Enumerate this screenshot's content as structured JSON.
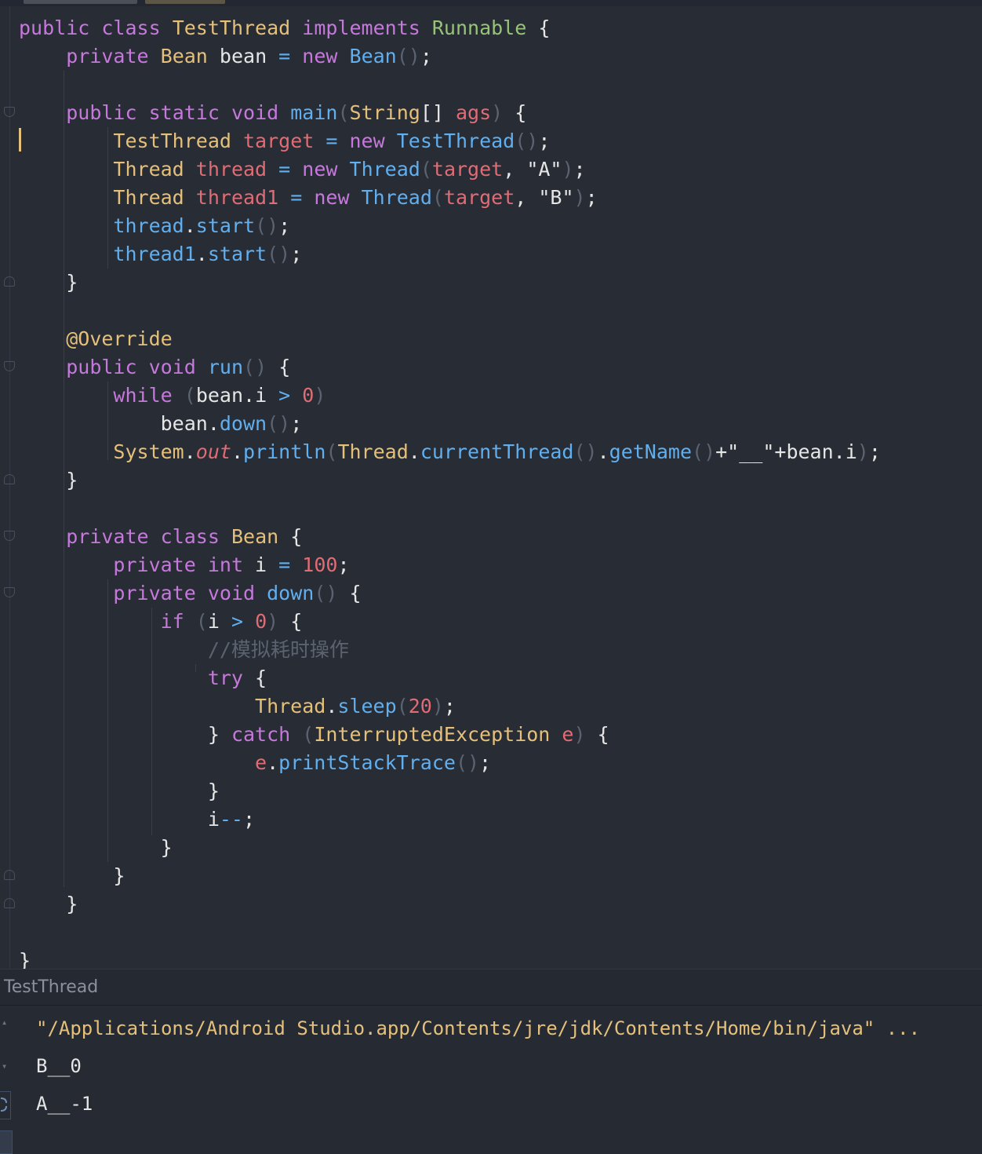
{
  "editor": {
    "lines": [
      [
        [
          "kw",
          "public"
        ],
        [
          "pl",
          " "
        ],
        [
          "kw",
          "class"
        ],
        [
          "pl",
          " "
        ],
        [
          "ty",
          "TestThread"
        ],
        [
          "pl",
          " "
        ],
        [
          "kw",
          "implements"
        ],
        [
          "pl",
          " "
        ],
        [
          "gr",
          "Runnable"
        ],
        [
          "pl",
          " {"
        ]
      ],
      [
        [
          "pl",
          "    "
        ],
        [
          "kw",
          "private"
        ],
        [
          "pl",
          " "
        ],
        [
          "ty",
          "Bean"
        ],
        [
          "pl",
          " bean "
        ],
        [
          "op",
          "="
        ],
        [
          "pl",
          " "
        ],
        [
          "kw",
          "new"
        ],
        [
          "pl",
          " "
        ],
        [
          "fn",
          "Bean"
        ],
        [
          "pu",
          "()"
        ],
        [
          "pl",
          ";"
        ]
      ],
      [],
      [
        [
          "pl",
          "    "
        ],
        [
          "kw",
          "public"
        ],
        [
          "pl",
          " "
        ],
        [
          "kw",
          "static"
        ],
        [
          "pl",
          " "
        ],
        [
          "kw",
          "void"
        ],
        [
          "pl",
          " "
        ],
        [
          "fn",
          "main"
        ],
        [
          "pu",
          "("
        ],
        [
          "ty",
          "String"
        ],
        [
          "pl",
          "[] "
        ],
        [
          "par",
          "ags"
        ],
        [
          "pu",
          ")"
        ],
        [
          "pl",
          " {"
        ]
      ],
      [
        [
          "pl",
          "        "
        ],
        [
          "ty",
          "TestThread"
        ],
        [
          "pl",
          " "
        ],
        [
          "par",
          "target"
        ],
        [
          "pl",
          " "
        ],
        [
          "op",
          "="
        ],
        [
          "pl",
          " "
        ],
        [
          "kw",
          "new"
        ],
        [
          "pl",
          " "
        ],
        [
          "fn",
          "TestThread"
        ],
        [
          "pu",
          "()"
        ],
        [
          "pl",
          ";"
        ]
      ],
      [
        [
          "pl",
          "        "
        ],
        [
          "ty",
          "Thread"
        ],
        [
          "pl",
          " "
        ],
        [
          "par",
          "thread"
        ],
        [
          "pl",
          " "
        ],
        [
          "op",
          "="
        ],
        [
          "pl",
          " "
        ],
        [
          "kw",
          "new"
        ],
        [
          "pl",
          " "
        ],
        [
          "fn",
          "Thread"
        ],
        [
          "pu",
          "("
        ],
        [
          "par",
          "target"
        ],
        [
          "pl",
          ", "
        ],
        [
          "st",
          "\"A\""
        ],
        [
          "pu",
          ")"
        ],
        [
          "pl",
          ";"
        ]
      ],
      [
        [
          "pl",
          "        "
        ],
        [
          "ty",
          "Thread"
        ],
        [
          "pl",
          " "
        ],
        [
          "par",
          "thread1"
        ],
        [
          "pl",
          " "
        ],
        [
          "op",
          "="
        ],
        [
          "pl",
          " "
        ],
        [
          "kw",
          "new"
        ],
        [
          "pl",
          " "
        ],
        [
          "fn",
          "Thread"
        ],
        [
          "pu",
          "("
        ],
        [
          "par",
          "target"
        ],
        [
          "pl",
          ", "
        ],
        [
          "st",
          "\"B\""
        ],
        [
          "pu",
          ")"
        ],
        [
          "pl",
          ";"
        ]
      ],
      [
        [
          "pl",
          "        "
        ],
        [
          "fn",
          "thread"
        ],
        [
          "pl",
          "."
        ],
        [
          "fn",
          "start"
        ],
        [
          "pu",
          "()"
        ],
        [
          "pl",
          ";"
        ]
      ],
      [
        [
          "pl",
          "        "
        ],
        [
          "fn",
          "thread1"
        ],
        [
          "pl",
          "."
        ],
        [
          "fn",
          "start"
        ],
        [
          "pu",
          "()"
        ],
        [
          "pl",
          ";"
        ]
      ],
      [
        [
          "pl",
          "    }"
        ]
      ],
      [],
      [
        [
          "pl",
          "    "
        ],
        [
          "an",
          "@Override"
        ]
      ],
      [
        [
          "pl",
          "    "
        ],
        [
          "kw",
          "public"
        ],
        [
          "pl",
          " "
        ],
        [
          "kw",
          "void"
        ],
        [
          "pl",
          " "
        ],
        [
          "fn",
          "run"
        ],
        [
          "pu",
          "()"
        ],
        [
          "pl",
          " {"
        ]
      ],
      [
        [
          "pl",
          "        "
        ],
        [
          "kw",
          "while"
        ],
        [
          "pl",
          " "
        ],
        [
          "pu",
          "("
        ],
        [
          "pl",
          "bean.i "
        ],
        [
          "op",
          ">"
        ],
        [
          "pl",
          " "
        ],
        [
          "nu",
          "0"
        ],
        [
          "pu",
          ")"
        ]
      ],
      [
        [
          "pl",
          "            bean."
        ],
        [
          "fn",
          "down"
        ],
        [
          "pu",
          "()"
        ],
        [
          "pl",
          ";"
        ]
      ],
      [
        [
          "pl",
          "        "
        ],
        [
          "ty",
          "System"
        ],
        [
          "pl",
          "."
        ],
        [
          "fi",
          "out"
        ],
        [
          "pl",
          "."
        ],
        [
          "fn",
          "println"
        ],
        [
          "pu",
          "("
        ],
        [
          "ty",
          "Thread"
        ],
        [
          "pl",
          "."
        ],
        [
          "fn",
          "currentThread"
        ],
        [
          "pu",
          "()"
        ],
        [
          "pl",
          "."
        ],
        [
          "fn",
          "getName"
        ],
        [
          "pu",
          "()"
        ],
        [
          "pl",
          "+\""
        ],
        [
          "st",
          "__"
        ],
        [
          "pl",
          "\"+bean.i"
        ],
        [
          "pu",
          ")"
        ],
        [
          "pl",
          ";"
        ]
      ],
      [
        [
          "pl",
          "    }"
        ]
      ],
      [],
      [
        [
          "pl",
          "    "
        ],
        [
          "kw",
          "private"
        ],
        [
          "pl",
          " "
        ],
        [
          "kw",
          "class"
        ],
        [
          "pl",
          " "
        ],
        [
          "ty",
          "Bean"
        ],
        [
          "pl",
          " {"
        ]
      ],
      [
        [
          "pl",
          "        "
        ],
        [
          "kw",
          "private"
        ],
        [
          "pl",
          " "
        ],
        [
          "kw",
          "int"
        ],
        [
          "pl",
          " i "
        ],
        [
          "op",
          "="
        ],
        [
          "pl",
          " "
        ],
        [
          "nu",
          "100"
        ],
        [
          "pl",
          ";"
        ]
      ],
      [
        [
          "pl",
          "        "
        ],
        [
          "kw",
          "private"
        ],
        [
          "pl",
          " "
        ],
        [
          "kw",
          "void"
        ],
        [
          "pl",
          " "
        ],
        [
          "fn",
          "down"
        ],
        [
          "pu",
          "()"
        ],
        [
          "pl",
          " {"
        ]
      ],
      [
        [
          "pl",
          "            "
        ],
        [
          "kw",
          "if"
        ],
        [
          "pl",
          " "
        ],
        [
          "pu",
          "("
        ],
        [
          "pl",
          "i "
        ],
        [
          "op",
          ">"
        ],
        [
          "pl",
          " "
        ],
        [
          "nu",
          "0"
        ],
        [
          "pu",
          ")"
        ],
        [
          "pl",
          " {"
        ]
      ],
      [
        [
          "pl",
          "                "
        ],
        [
          "cm",
          "//模拟耗时操作"
        ]
      ],
      [
        [
          "pl",
          "                "
        ],
        [
          "kw",
          "try"
        ],
        [
          "pl",
          " {"
        ]
      ],
      [
        [
          "pl",
          "                    "
        ],
        [
          "ty",
          "Thread"
        ],
        [
          "pl",
          "."
        ],
        [
          "fn",
          "sleep"
        ],
        [
          "pu",
          "("
        ],
        [
          "nu",
          "20"
        ],
        [
          "pu",
          ")"
        ],
        [
          "pl",
          ";"
        ]
      ],
      [
        [
          "pl",
          "                } "
        ],
        [
          "kw",
          "catch"
        ],
        [
          "pl",
          " "
        ],
        [
          "pu",
          "("
        ],
        [
          "ty",
          "InterruptedException"
        ],
        [
          "pl",
          " "
        ],
        [
          "par",
          "e"
        ],
        [
          "pu",
          ")"
        ],
        [
          "pl",
          " {"
        ]
      ],
      [
        [
          "pl",
          "                    "
        ],
        [
          "par",
          "e"
        ],
        [
          "pl",
          "."
        ],
        [
          "fn",
          "printStackTrace"
        ],
        [
          "pu",
          "()"
        ],
        [
          "pl",
          ";"
        ]
      ],
      [
        [
          "pl",
          "                }"
        ]
      ],
      [
        [
          "pl",
          "                i"
        ],
        [
          "op",
          "--"
        ],
        [
          "pl",
          ";"
        ]
      ],
      [
        [
          "pl",
          "            }"
        ]
      ],
      [
        [
          "pl",
          "        }"
        ]
      ],
      [
        [
          "pl",
          "    }"
        ]
      ],
      [],
      [
        [
          "pl",
          "}"
        ]
      ]
    ]
  },
  "run_panel": {
    "title": "TestThread",
    "console_lines": [
      "\"/Applications/Android Studio.app/Contents/jre/jdk/Contents/Home/bin/java\" ...",
      "B__0",
      "A__-1"
    ]
  }
}
